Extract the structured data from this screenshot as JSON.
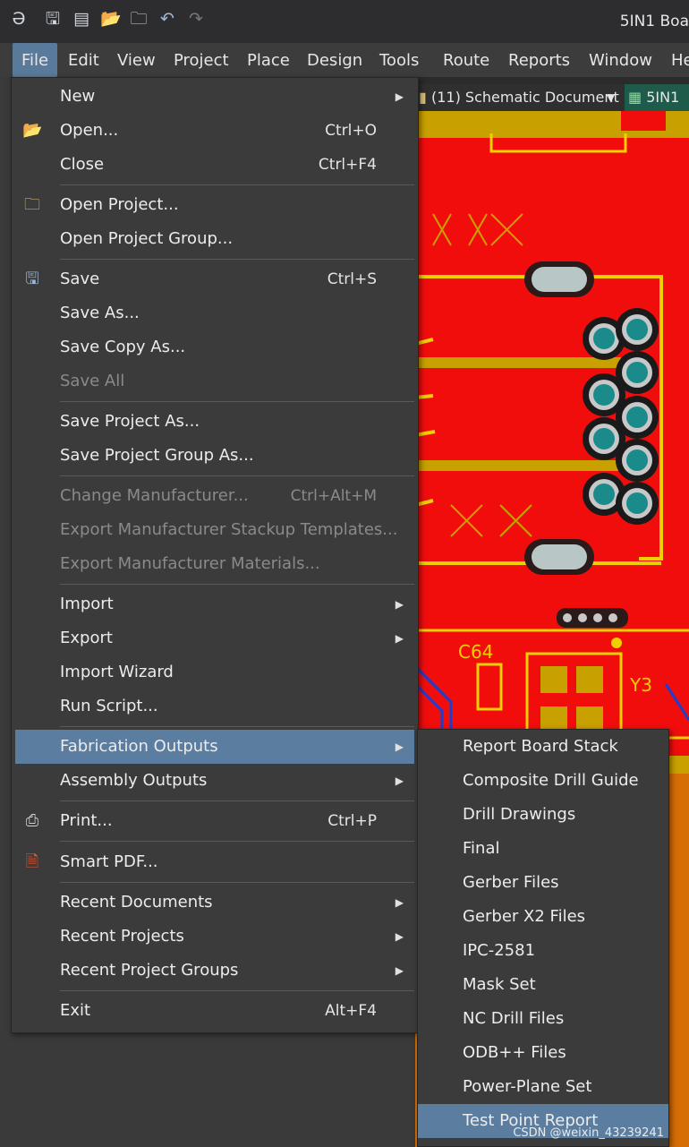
{
  "window": {
    "title": "5IN1 Boa"
  },
  "toolbar": [
    "app-logo-icon",
    "save-icon",
    "save-all-icon",
    "open-icon",
    "open-project-icon",
    "undo-icon",
    "redo-icon"
  ],
  "menubar": {
    "items": [
      "File",
      "Edit",
      "View",
      "Project",
      "Place",
      "Design",
      "Tools",
      "Route",
      "Reports",
      "Window",
      "He"
    ]
  },
  "tabs": [
    {
      "label": "(11) Schematic Document",
      "icon": "schematic-doc-icon"
    },
    {
      "label": "5IN1",
      "icon": "pcb-doc-icon"
    }
  ],
  "file_menu": {
    "items": [
      {
        "label": "New",
        "submenu": true
      },
      {
        "label": "Open...",
        "shortcut": "Ctrl+O",
        "icon": "open-folder-icon"
      },
      {
        "label": "Close",
        "shortcut": "Ctrl+F4"
      },
      {
        "label": "Open Project...",
        "icon": "open-project-icon"
      },
      {
        "label": "Open Project Group..."
      },
      {
        "label": "Save",
        "shortcut": "Ctrl+S",
        "icon": "floppy-icon"
      },
      {
        "label": "Save As..."
      },
      {
        "label": "Save Copy As..."
      },
      {
        "label": "Save All",
        "disabled": true
      },
      {
        "label": "Save Project As..."
      },
      {
        "label": "Save Project Group As..."
      },
      {
        "label": "Change Manufacturer...",
        "shortcut": "Ctrl+Alt+M",
        "disabled": true
      },
      {
        "label": "Export Manufacturer Stackup Templates...",
        "disabled": true
      },
      {
        "label": "Export Manufacturer Materials...",
        "disabled": true
      },
      {
        "label": "Import",
        "submenu": true
      },
      {
        "label": "Export",
        "submenu": true
      },
      {
        "label": "Import Wizard"
      },
      {
        "label": "Run Script..."
      },
      {
        "label": "Fabrication Outputs",
        "submenu": true,
        "highlighted": true
      },
      {
        "label": "Assembly Outputs",
        "submenu": true
      },
      {
        "label": "Print...",
        "shortcut": "Ctrl+P",
        "icon": "printer-icon"
      },
      {
        "label": "Smart PDF...",
        "icon": "smart-pdf-icon"
      },
      {
        "label": "Recent Documents",
        "submenu": true
      },
      {
        "label": "Recent Projects",
        "submenu": true
      },
      {
        "label": "Recent Project Groups",
        "submenu": true
      },
      {
        "label": "Exit",
        "shortcut": "Alt+F4"
      }
    ]
  },
  "fabrication_submenu": {
    "items": [
      "Report Board Stack",
      "Composite Drill Guide",
      "Drill Drawings",
      "Final",
      "Gerber Files",
      "Gerber X2 Files",
      "IPC-2581",
      "Mask Set",
      "NC Drill Files",
      "ODB++ Files",
      "Power-Plane Set",
      "Test Point Report"
    ],
    "highlighted": "Test Point Report"
  },
  "pcb": {
    "labels": [
      "C64",
      "Y3"
    ]
  },
  "watermark": "CSDN @weixin_43239241",
  "colors": {
    "menu_bg": "#3b3b3b",
    "highlight": "#5b7da0",
    "pcb_red": "#f20d0d",
    "trace_yellow": "#f0d000",
    "copper": "#c8a000",
    "via_teal": "#1a8a8a"
  }
}
